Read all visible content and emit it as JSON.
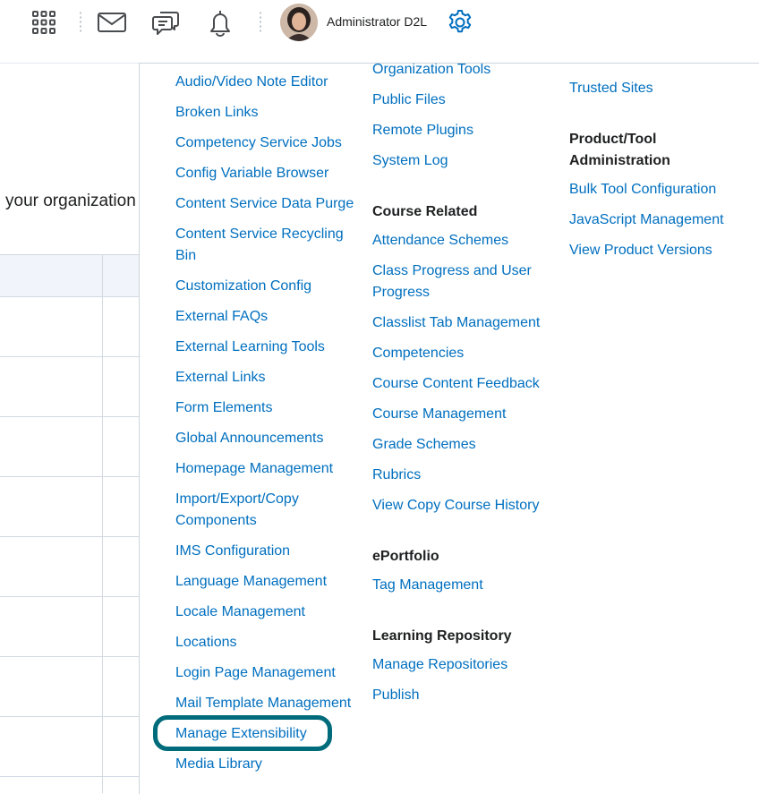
{
  "topbar": {
    "icons": [
      "grid-icon",
      "mail-icon",
      "chat-icon",
      "bell-icon",
      "gear-icon"
    ],
    "username": "Administrator D2L"
  },
  "background": {
    "text": "your organization"
  },
  "menu": {
    "col1": [
      "Audio/Video Note Editor",
      "Broken Links",
      "Competency Service Jobs",
      "Config Variable Browser",
      "Content Service Data Purge",
      "Content Service Recycling",
      "Bin",
      "Customization Config",
      "External FAQs",
      "External Learning Tools",
      "External Links",
      "Form Elements",
      "Global Announcements",
      "Homepage Management",
      "Import/Export/Copy",
      "Components",
      "IMS Configuration",
      "Language Management",
      "Locale Management",
      "Locations",
      "Login Page Management",
      "Mail Template Management",
      "Manage Extensibility",
      "Media Library"
    ],
    "col2_top": [
      "Organization Tools",
      "Public Files",
      "Remote Plugins",
      "System Log"
    ],
    "course_related": {
      "heading": "Course Related",
      "items": [
        "Attendance Schemes",
        "Class Progress and User",
        "Progress",
        "Classlist Tab Management",
        "Competencies",
        "Course Content Feedback",
        "Course Management",
        "Grade Schemes",
        "Rubrics",
        "View Copy Course History"
      ]
    },
    "eportfolio": {
      "heading": "ePortfolio",
      "items": [
        "Tag Management"
      ]
    },
    "learning_repository": {
      "heading": "Learning Repository",
      "items": [
        "Manage Repositories",
        "Publish"
      ]
    },
    "col3_top": [
      "Trusted Sites"
    ],
    "product_tool": {
      "heading_line1": "Product/Tool",
      "heading_line2": "Administration",
      "items": [
        "Bulk Tool Configuration",
        "JavaScript Management",
        "View Product Versions"
      ]
    }
  },
  "colors": {
    "link": "#006fbf",
    "highlight": "#006b7b",
    "icon": "#494c4e",
    "accent": "#006fbf"
  }
}
